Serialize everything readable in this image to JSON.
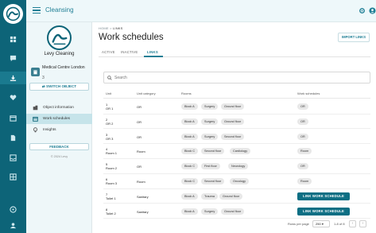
{
  "colors": {
    "primary": "#0d6478",
    "accent": "#1f7f95",
    "active_nav": "#c6e4ea",
    "chip": "#e8e8e8"
  },
  "topbar": {
    "title": "Cleansing",
    "icons": [
      "gear-icon",
      "user-icon"
    ]
  },
  "rail": {
    "icons": [
      "dashboard-icon",
      "chat-icon",
      "download-icon",
      "heart-icon",
      "calendar-icon",
      "document-icon",
      "inbox-icon",
      "grid-icon",
      "help-icon",
      "profile-icon"
    ]
  },
  "sidebar": {
    "org_name": "Levy Cleaning",
    "site_name": "Medical Centre London",
    "site_number": "3",
    "switch_label": "SWITCH OBJECT",
    "nav": [
      {
        "label": "Object information",
        "icon": "building-icon"
      },
      {
        "label": "Work schedules",
        "icon": "calendar-icon"
      },
      {
        "label": "Insights",
        "icon": "lightbulb-icon"
      }
    ],
    "feedback_label": "FEEDBACK",
    "copyright": "© 2024 Levy"
  },
  "main": {
    "breadcrumb_home": "HOME",
    "breadcrumb_sep": ">",
    "breadcrumb_current": "LINKS",
    "title": "Work schedules",
    "import_label": "IMPORT LINKS",
    "tabs": [
      "ACTIVE",
      "INACTIVE",
      "LINKS"
    ],
    "search_placeholder": "Search",
    "columns": [
      "Unit",
      "Unit category",
      "Rooms",
      "Work schedules"
    ],
    "link_label": "LINK WORK SCHEDULE",
    "rows": [
      {
        "unit_num": "1",
        "unit_name": "OR 1",
        "category": "OR",
        "rooms": [
          "Block A",
          "Surgery",
          "Ground floor"
        ],
        "schedule": "OR"
      },
      {
        "unit_num": "2",
        "unit_name": "OR 2",
        "category": "OR",
        "rooms": [
          "Block A",
          "Surgery",
          "Ground floor"
        ],
        "schedule": "OR"
      },
      {
        "unit_num": "3",
        "unit_name": "OR 3",
        "category": "OR",
        "rooms": [
          "Block A",
          "Surgery",
          "Second floor"
        ],
        "schedule": "OR"
      },
      {
        "unit_num": "4",
        "unit_name": "Room 1",
        "category": "Room",
        "rooms": [
          "Block C",
          "Second floor",
          "Cardiology"
        ],
        "schedule": "Room"
      },
      {
        "unit_num": "5",
        "unit_name": "Room 2",
        "category": "OR",
        "rooms": [
          "Block C",
          "First floor",
          "Neurology"
        ],
        "schedule": "OR"
      },
      {
        "unit_num": "6",
        "unit_name": "Room 3",
        "category": "Room",
        "rooms": [
          "Block C",
          "Second floor",
          "Oncology"
        ],
        "schedule": "Room"
      },
      {
        "unit_num": "7",
        "unit_name": "Toilet 1",
        "category": "Sanitary",
        "rooms": [
          "Block A",
          "Trauma",
          "Ground floor"
        ],
        "schedule": ""
      },
      {
        "unit_num": "8",
        "unit_name": "Toilet 2",
        "category": "Sanitary",
        "rooms": [
          "Block A",
          "Surgery",
          "Ground floor"
        ],
        "schedule": ""
      }
    ],
    "pager": {
      "rows_per_page_label": "Rows per page",
      "rows_per_page": "250",
      "range": "1-8 of 8"
    }
  }
}
